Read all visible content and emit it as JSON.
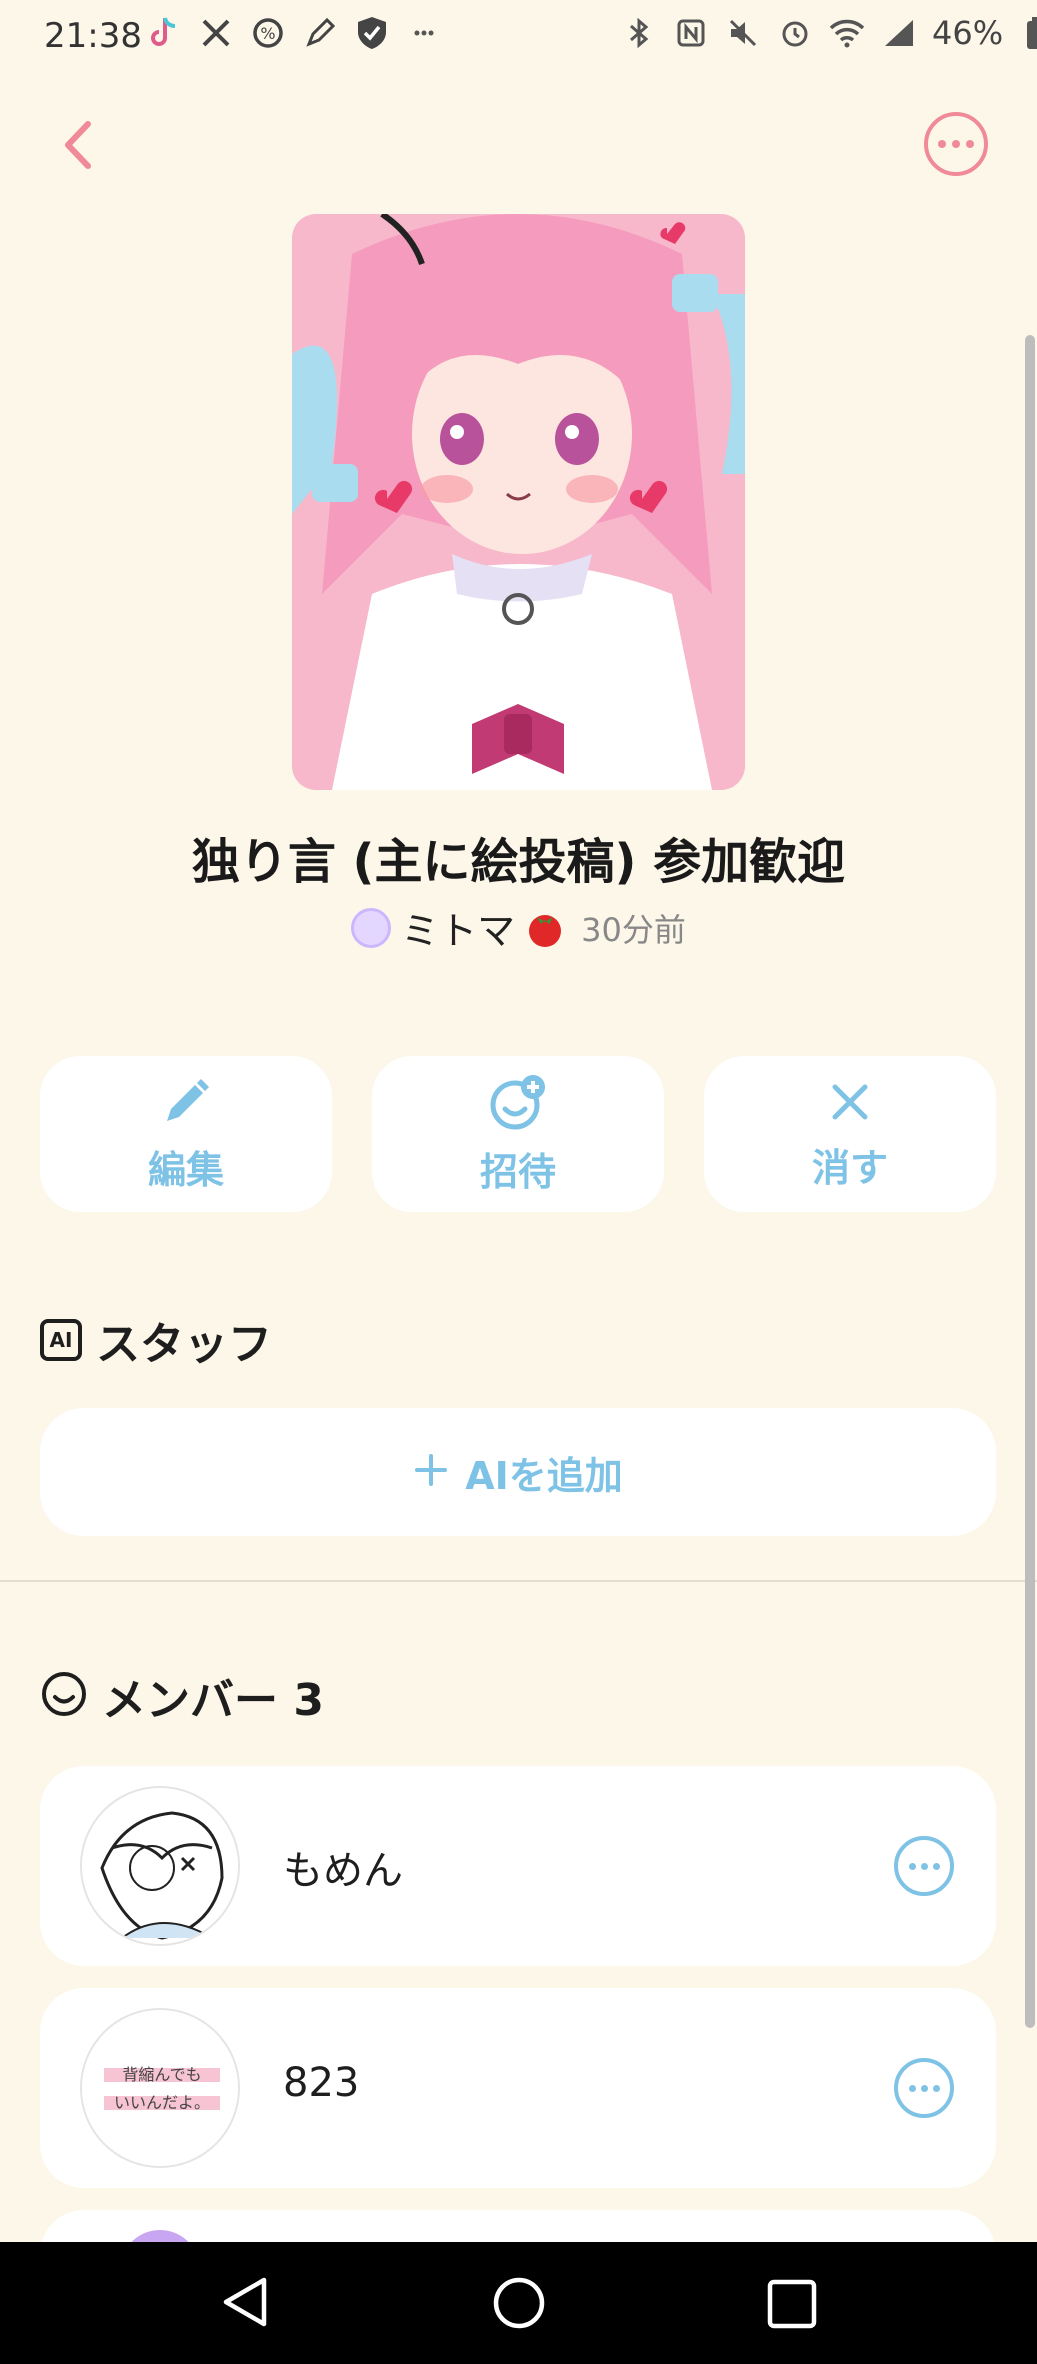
{
  "status_bar": {
    "time": "21:38",
    "battery": "46%"
  },
  "post": {
    "title": "独り言 (主に絵投稿) 参加歓迎",
    "author": "ミトマ",
    "time_ago": "30分前"
  },
  "actions": [
    {
      "label": "編集",
      "icon": "pencil-icon"
    },
    {
      "label": "招待",
      "icon": "add-person-icon"
    },
    {
      "label": "消す",
      "icon": "close-icon"
    }
  ],
  "staff": {
    "title": "スタッフ",
    "ai_badge": "AI",
    "add_ai_label": "AIを追加"
  },
  "members": {
    "title": "メンバー 3",
    "items": [
      {
        "name": "もめん"
      },
      {
        "name": "823",
        "avatar_text": "背縮んでもいいんだよ。"
      }
    ]
  },
  "colors": {
    "accent": "#7ec2e6",
    "back": "#f08a98",
    "background": "#fdf7ea"
  }
}
